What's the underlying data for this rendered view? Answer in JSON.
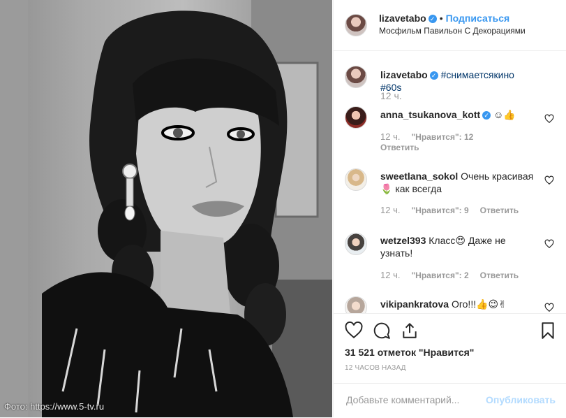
{
  "photo": {
    "credit": "Фото: https://www.5-tv.ru"
  },
  "header": {
    "username": "lizavetabo",
    "follow_label": "Подписаться",
    "dot": "•",
    "location": "Мосфильм Павильон С Декорациями",
    "more_icon": "more-horizontal-icon"
  },
  "caption": {
    "username": "lizavetabo",
    "text": "#снимаетсякино #60s",
    "time": "12 ч."
  },
  "comments": [
    {
      "username": "anna_tsukanova_kott",
      "text": "☺👍",
      "time": "12 ч.",
      "likes": "\"Нравится\": 12",
      "reply": "Ответить"
    },
    {
      "username": "sweetlana_sokol",
      "text": "Очень красивая 🌷 как всегда",
      "time": "12 ч.",
      "likes": "\"Нравится\": 9",
      "reply": "Ответить"
    },
    {
      "username": "wetzel393",
      "text": "Класс😍 Даже не узнать!",
      "time": "12 ч.",
      "likes": "\"Нравится\": 2",
      "reply": "Ответить"
    },
    {
      "username": "vikipankratova",
      "text": "Ого!!!👍😉✌"
    }
  ],
  "actions": {
    "likes_count": "31 521 отметок \"Нравится\"",
    "time_ago": "12 ЧАСОВ НАЗАД",
    "icons": [
      "heart-icon",
      "comment-icon",
      "share-icon",
      "bookmark-icon"
    ]
  },
  "add_comment": {
    "placeholder": "Добавьте комментарий...",
    "post_label": "Опубликовать"
  },
  "colors": {
    "accent": "#3897f0",
    "secondary_text": "#999999",
    "post_disabled": "#b3dbff"
  }
}
